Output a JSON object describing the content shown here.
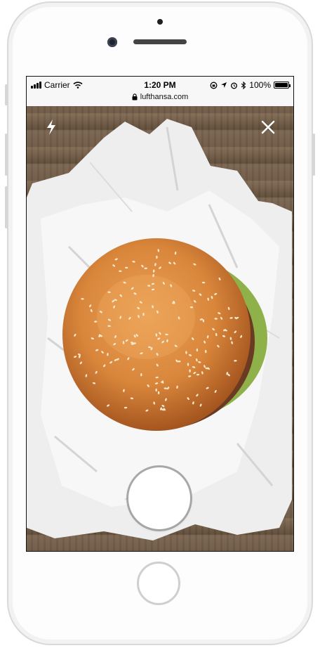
{
  "status_bar": {
    "carrier": "Carrier",
    "time": "1:20 PM",
    "battery_percent": "100%",
    "url": "lufthansa.com"
  },
  "camera": {
    "flash_icon": "flash-icon",
    "close_icon": "close-icon",
    "shutter_icon": "shutter-button"
  },
  "colors": {
    "bun": "#d98a3d",
    "wood": "#6e5a45",
    "paper": "#f2f2f2"
  }
}
